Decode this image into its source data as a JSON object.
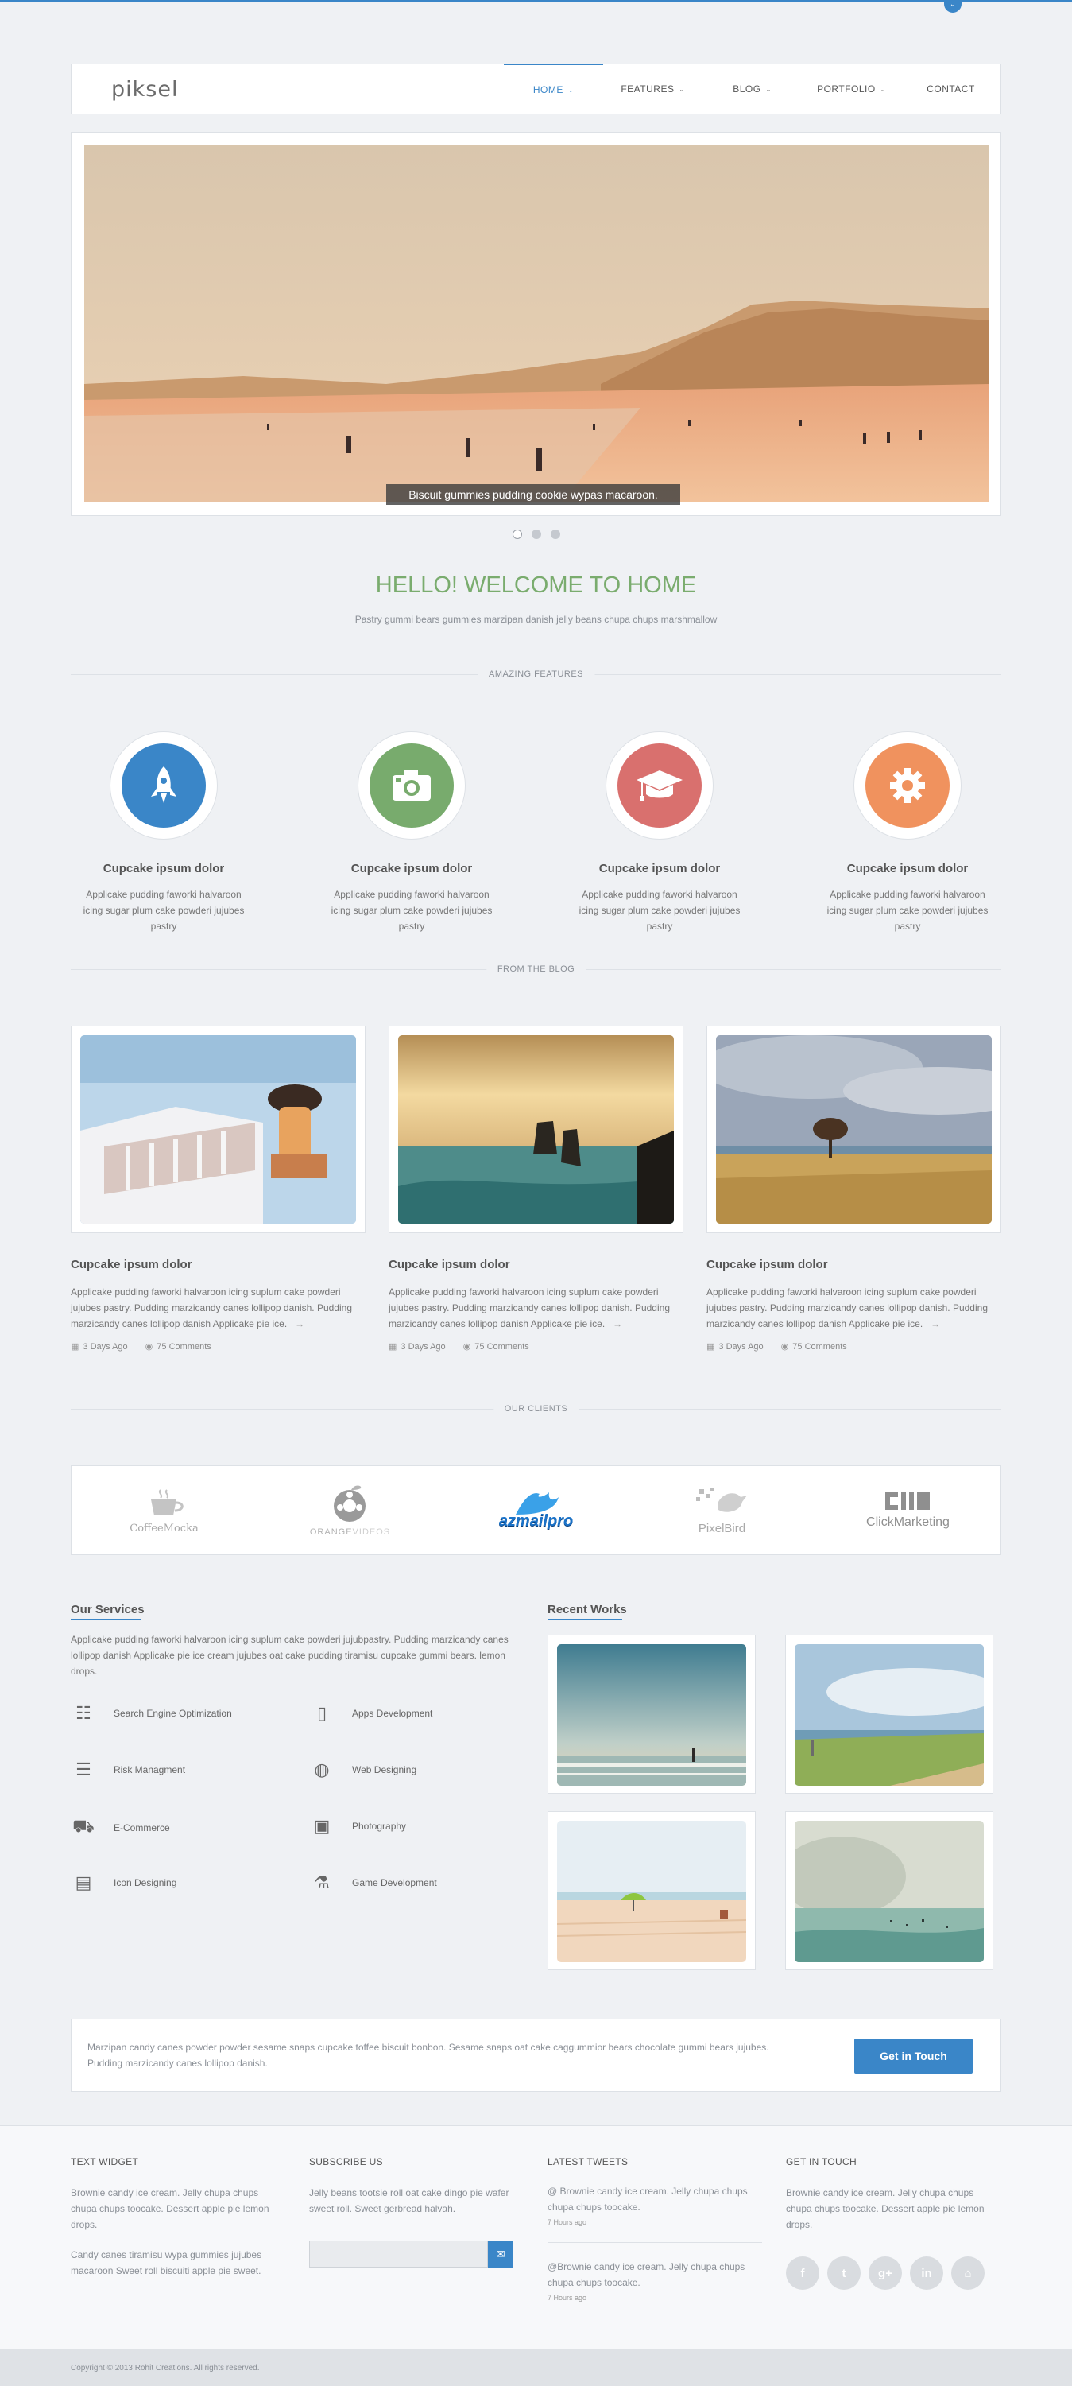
{
  "site": {
    "logo": "piksel",
    "accent": "#3a86c8"
  },
  "nav": {
    "items": [
      {
        "label": "HOME",
        "active": true,
        "has_menu": true
      },
      {
        "label": "FEATURES",
        "has_menu": true
      },
      {
        "label": "BLOG",
        "has_menu": true
      },
      {
        "label": "PORTFOLIO",
        "has_menu": true
      },
      {
        "label": "CONTACT",
        "has_menu": false
      }
    ]
  },
  "slider": {
    "caption": "Biscuit gummies pudding cookie wypas macaroon.",
    "slide_count": 3,
    "active_slide": 1
  },
  "welcome": {
    "title": "HELLO! WELCOME TO HOME",
    "subtitle": "Pastry gummi bears gummies marzipan danish jelly beans chupa chups marshmallow"
  },
  "sections": {
    "features": "AMAZING FEATURES",
    "blog": "FROM THE BLOG",
    "clients": "OUR CLIENTS"
  },
  "features": [
    {
      "icon": "rocket-icon",
      "color": "#3a86c8",
      "title": "Cupcake ipsum dolor",
      "text": "Applicake pudding faworki halvaroon icing sugar plum cake powderi jujubes pastry"
    },
    {
      "icon": "camera-icon",
      "color": "#78ab6d",
      "title": "Cupcake ipsum dolor",
      "text": "Applicake pudding faworki halvaroon icing sugar plum cake powderi jujubes pastry"
    },
    {
      "icon": "graduation-cap-icon",
      "color": "#d9706e",
      "title": "Cupcake ipsum dolor",
      "text": "Applicake pudding faworki halvaroon icing sugar plum cake powderi jujubes pastry"
    },
    {
      "icon": "gear-icon",
      "color": "#f0925e",
      "title": "Cupcake ipsum dolor",
      "text": "Applicake pudding faworki halvaroon icing sugar plum cake powderi jujubes pastry"
    }
  ],
  "posts": [
    {
      "image": "woman-balcony-sea",
      "title": "Cupcake ipsum dolor",
      "text": "Applicake pudding faworki halvaroon icing suplum cake powderi jujubes pastry. Pudding marzicandy canes lollipop danish. Pudding marzicandy canes lollipop danish Applicake pie ice.",
      "arrow": "→",
      "date": "3 Days Ago",
      "comments": "75 Comments"
    },
    {
      "image": "sea-cliffs-sunset",
      "title": "Cupcake ipsum dolor",
      "text": "Applicake pudding faworki halvaroon icing suplum cake powderi jujubes pastry. Pudding marzicandy canes lollipop danish. Pudding marzicandy canes lollipop danish Applicake pie ice.",
      "arrow": "→",
      "date": "3 Days Ago",
      "comments": "75 Comments"
    },
    {
      "image": "tree-wheat-field",
      "title": "Cupcake ipsum dolor",
      "text": "Applicake pudding faworki halvaroon icing suplum cake powderi jujubes pastry. Pudding marzicandy canes lollipop danish. Pudding marzicandy canes lollipop danish Applicake pie ice.",
      "arrow": "→",
      "date": "3 Days Ago",
      "comments": "75 Comments"
    }
  ],
  "clients": [
    {
      "name": "CoffeeMocka"
    },
    {
      "name": "ORANGE",
      "name2": "VIDEOS"
    },
    {
      "name": "azmailpro"
    },
    {
      "name": "PixelBird"
    },
    {
      "name": "ClickMarketing"
    }
  ],
  "services": {
    "title": "Our Services",
    "intro": "Applicake pudding faworki halvaroon icing suplum cake powderi jujubpastry. Pudding marzicandy canes lollipop danish Applicake pie ice cream jujubes oat cake pudding tiramisu cupcake gummi bears. lemon drops.",
    "items": [
      {
        "icon": "bar-chart-icon",
        "glyph": "☷",
        "label": "Search Engine Optimization"
      },
      {
        "icon": "tablet-icon",
        "glyph": "▯",
        "label": "Apps Development"
      },
      {
        "icon": "list-icon",
        "glyph": "☰",
        "label": "Risk Managment"
      },
      {
        "icon": "globe-icon",
        "glyph": "◍",
        "label": "Web Designing"
      },
      {
        "icon": "cart-icon",
        "glyph": "⛟",
        "label": "E-Commerce"
      },
      {
        "icon": "camera-icon",
        "glyph": "▣",
        "label": "Photography"
      },
      {
        "icon": "briefcase-icon",
        "glyph": "▤",
        "label": "Icon Designing"
      },
      {
        "icon": "flask-icon",
        "glyph": "⚗",
        "label": "Game Development"
      }
    ]
  },
  "recent_works": {
    "title": "Recent Works",
    "items": [
      "surfer-beach",
      "grassy-shore",
      "umbrella-beach",
      "misty-sea"
    ]
  },
  "cta": {
    "text": "Marzipan candy canes powder powder sesame snaps cupcake toffee biscuit bonbon. Sesame snaps oat cake caggummior bears chocolate gummi bears jujubes. Pudding marzicandy canes lollipop danish.",
    "button": "Get in Touch"
  },
  "footer": {
    "text_widget": {
      "title": "TEXT WIDGET",
      "p1": "Brownie candy ice cream. Jelly chupa chups chupa chups toocake. Dessert apple pie lemon drops.",
      "p2": "Candy canes tiramisu wypa gummies jujubes macaroon Sweet roll biscuiti apple pie sweet."
    },
    "subscribe": {
      "title": "SUBSCRIBE US",
      "text": "Jelly beans tootsie roll oat cake dingo pie wafer sweet roll. Sweet gerbread halvah.",
      "placeholder": ""
    },
    "tweets": {
      "title": "LATEST TWEETS",
      "items": [
        {
          "text": "@ Brownie candy ice cream. Jelly chupa chups chupa chups toocake.",
          "time": "7 Hours ago"
        },
        {
          "text": "@Brownie candy ice cream. Jelly chupa chups chupa chups toocake.",
          "time": "7 Hours ago"
        }
      ]
    },
    "contact": {
      "title": "GET IN TOUCH",
      "text": "Brownie candy ice cream. Jelly chupa chups chupa chups toocake. Dessert apple pie lemon drops.",
      "socials": [
        {
          "icon": "facebook-icon",
          "glyph": "f"
        },
        {
          "icon": "twitter-icon",
          "glyph": "t"
        },
        {
          "icon": "google-plus-icon",
          "glyph": "g+"
        },
        {
          "icon": "linkedin-icon",
          "glyph": "in"
        },
        {
          "icon": "github-icon",
          "glyph": "⌂"
        }
      ]
    },
    "copyright": "Copyright © 2013 Rohit Creations. All rights reserved."
  }
}
